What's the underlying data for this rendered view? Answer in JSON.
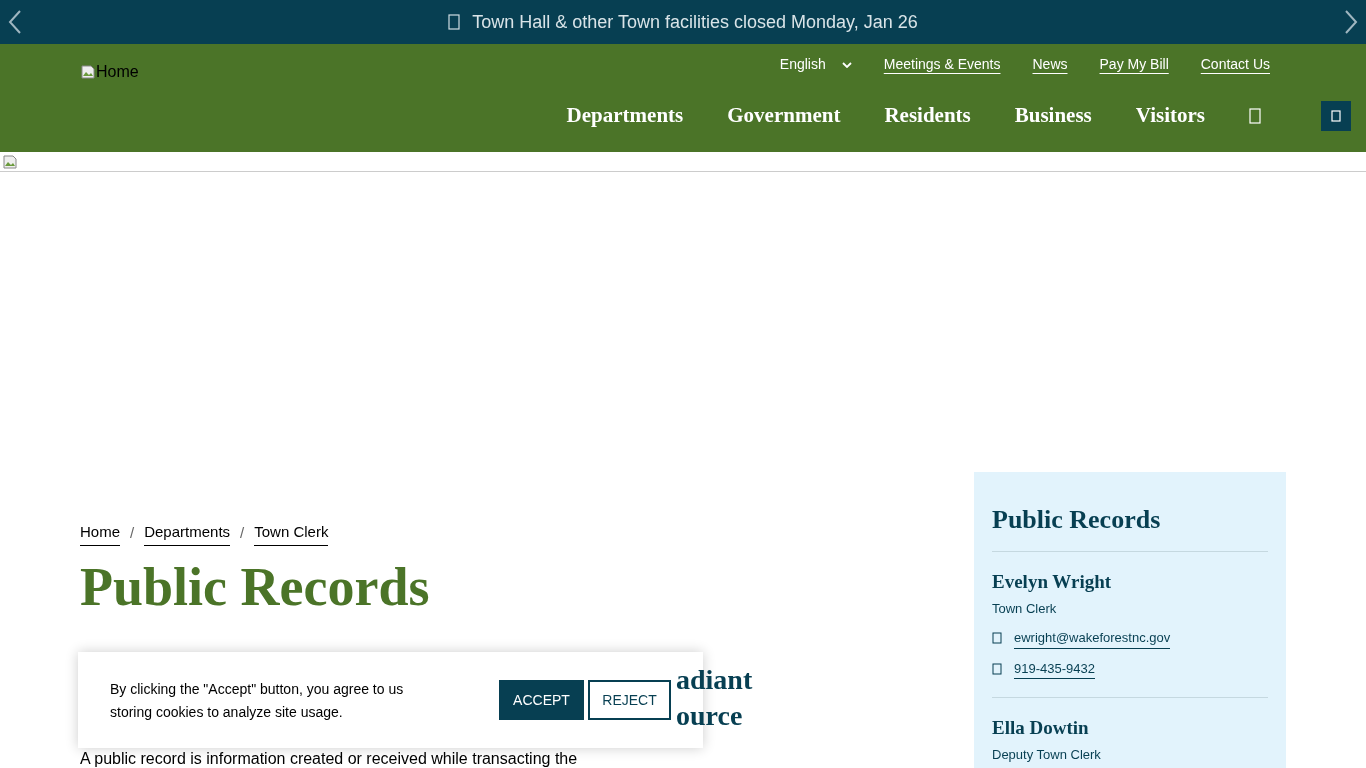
{
  "alert_bar": {
    "text": "Town Hall & other Town facilities closed Monday, Jan 26"
  },
  "header": {
    "logo_alt": "Home",
    "language": "English",
    "utility_links": [
      "Meetings & Events",
      "News",
      "Pay My Bill",
      "Contact Us"
    ],
    "nav": [
      "Departments",
      "Government",
      "Residents",
      "Business",
      "Visitors"
    ]
  },
  "breadcrumbs": [
    "Home",
    "Departments",
    "Town Clerk"
  ],
  "breadcrumb_separator": "/",
  "page_title": "Public Records",
  "side_heading": [
    "adiant",
    "ource"
  ],
  "body_text": "A public record is information created or received while transacting the",
  "sidebar": {
    "title": "Public Records",
    "contacts": [
      {
        "name": "Evelyn Wright",
        "role": "Town Clerk",
        "email": "ewright@wakeforestnc.gov",
        "phone": "919-435-9432"
      },
      {
        "name": "Ella Dowtin",
        "role": "Deputy Town Clerk"
      }
    ]
  },
  "cookie_banner": {
    "text": "By clicking the \"Accept\" button, you agree to us storing cookies to analyze site usage.",
    "accept": "ACCEPT",
    "reject": "REJECT"
  }
}
